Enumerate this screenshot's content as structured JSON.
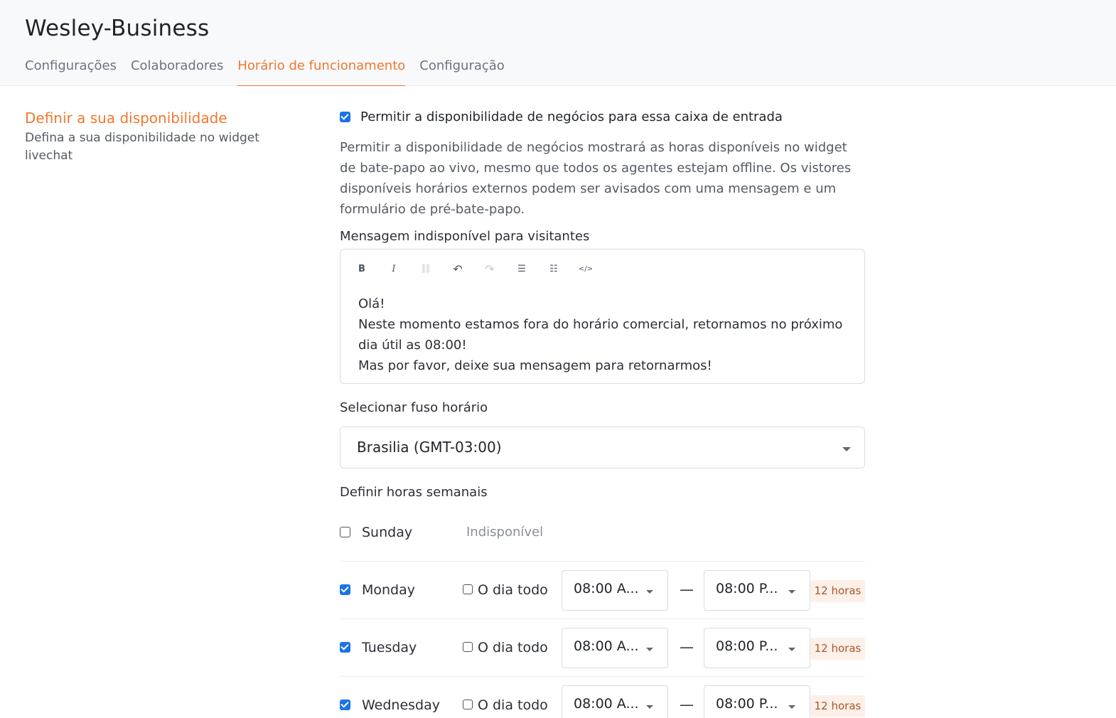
{
  "header": {
    "title": "Wesley-Business",
    "tabs": [
      {
        "label": "Configurações"
      },
      {
        "label": "Colaboradores"
      },
      {
        "label": "Horário de funcionamento"
      },
      {
        "label": "Configuração"
      }
    ],
    "active_tab": 2
  },
  "left": {
    "title": "Definir a sua disponibilidade",
    "description": "Defina a sua disponibilidade no widget livechat"
  },
  "availability": {
    "checkbox_label": "Permitir a disponibilidade de negócios para essa caixa de entrada",
    "checked": true,
    "description": "Permitir a disponibilidade de negócios mostrará as horas disponíveis no widget de bate-papo ao vivo, mesmo que todos os agentes estejam offline. Os vistores disponíveis horários externos podem ser avisados com uma mensagem e um formulário de pré-bate-papo."
  },
  "unavailable_message": {
    "label": "Mensagem indisponível para visitantes",
    "toolbar": {
      "bold": "B",
      "italic": "I",
      "link": "⛓",
      "undo": "↶",
      "redo": "↷",
      "bullet_list": "☰",
      "ordered_list": "☷",
      "code": "</>"
    },
    "lines": [
      "Olá!",
      "Neste momento estamos fora do horário comercial, retornamos no próximo dia útil as 08:00!",
      "Mas por favor, deixe sua mensagem para retornarmos!"
    ]
  },
  "timezone": {
    "label": "Selecionar fuso horário",
    "value": "Brasilia (GMT-03:00)"
  },
  "weekly_hours": {
    "label": "Definir horas semanais",
    "days": [
      {
        "name": "Sunday",
        "enabled": false,
        "unavailable_text": "Indisponível"
      },
      {
        "name": "Monday",
        "enabled": true,
        "all_day_label": "O dia todo",
        "from": "08:00 A...",
        "dash": "—",
        "to": "08:00 P...",
        "duration": "12 horas"
      },
      {
        "name": "Tuesday",
        "enabled": true,
        "all_day_label": "O dia todo",
        "from": "08:00 A...",
        "dash": "—",
        "to": "08:00 P...",
        "duration": "12 horas"
      },
      {
        "name": "Wednesday",
        "enabled": true,
        "all_day_label": "O dia todo",
        "from": "08:00 A...",
        "dash": "—",
        "to": "08:00 P...",
        "duration": "12 horas"
      }
    ]
  },
  "colors": {
    "accent": "#f0782f",
    "checkbox": "#1a73e8",
    "badge_bg": "#fdf0e8"
  }
}
